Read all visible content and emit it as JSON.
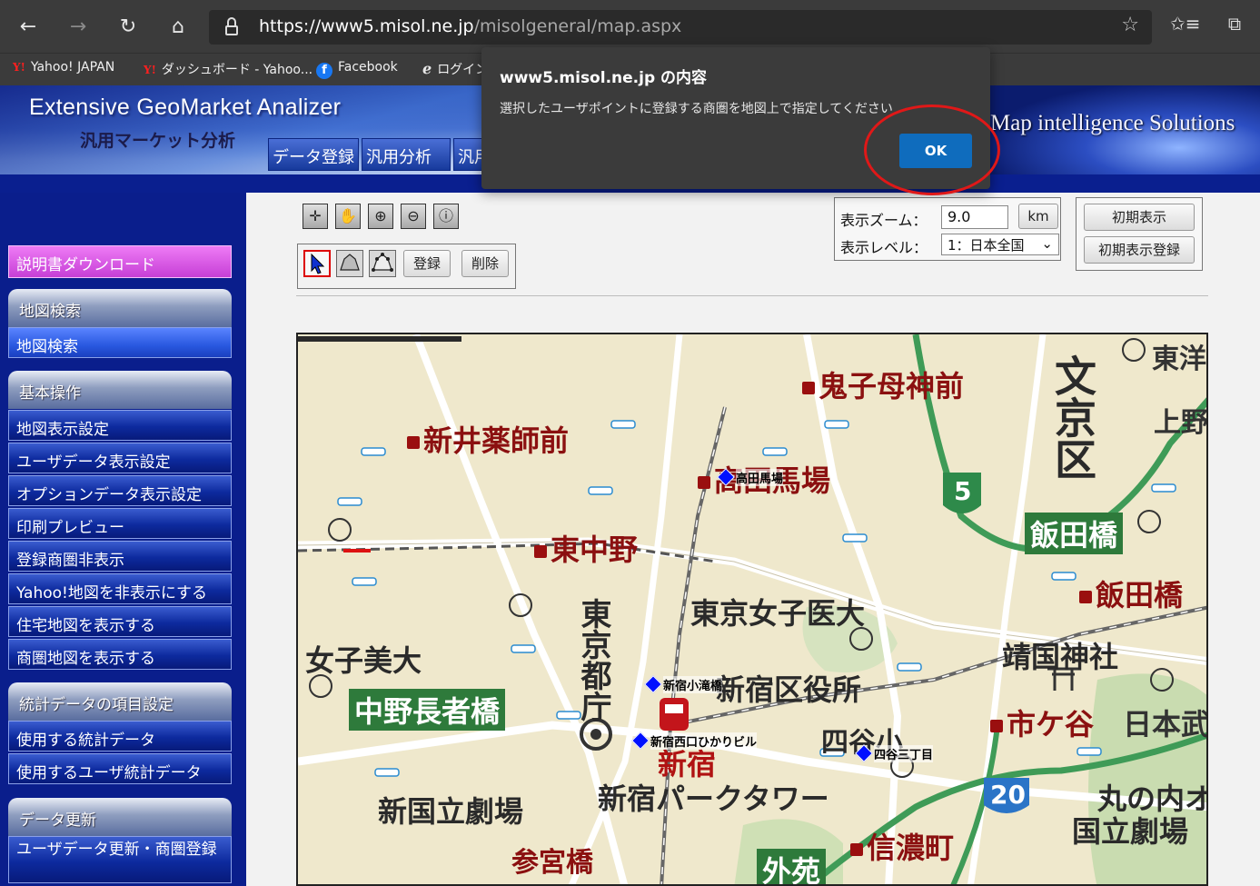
{
  "browser": {
    "url_host": "https://www5.misol.ne.jp",
    "url_path": "/misolgeneral/map.aspx",
    "back_icon": "←",
    "forward_icon": "→",
    "reload_icon": "↻",
    "home_icon": "⌂",
    "star_icon": "☆",
    "favorites_icon": "✩≡",
    "collections_icon": "⧉",
    "bookmarks": [
      {
        "label": "Yahoo! JAPAN",
        "icon": "yahoo-icon"
      },
      {
        "label": "ダッシュボード - Yahoo...",
        "icon": "yahoo-icon"
      },
      {
        "label": "Facebook",
        "icon": "facebook-icon"
      },
      {
        "label": "ログイン",
        "icon": "login-icon"
      }
    ]
  },
  "header": {
    "title": "Extensive GeoMarket Analizer",
    "subtitle": "汎用マーケット分析",
    "tabs": [
      "データ登録",
      "汎用分析",
      "汎用"
    ],
    "tagline": "Map intelligence Solutions"
  },
  "sidebar": {
    "download": "説明書ダウンロード",
    "sections": [
      {
        "title": "地図検索",
        "items": [
          "地図検索"
        ]
      },
      {
        "title": "基本操作",
        "items": [
          "地図表示設定",
          "ユーザデータ表示設定",
          "オプションデータ表示設定",
          "印刷プレビュー",
          "登録商圏非表示",
          "Yahoo!地図を非表示にする",
          "住宅地図を表示する",
          "商圏地図を表示する"
        ]
      },
      {
        "title": "統計データの項目設定",
        "items": [
          "使用する統計データ",
          "使用するユーザ統計データ"
        ]
      },
      {
        "title": "データ更新",
        "items": [
          "ユーザデータ更新・商圏登録"
        ]
      }
    ]
  },
  "toolbar": {
    "register": "登録",
    "delete": "削除",
    "zoom_label": "表示ズーム：",
    "zoom_value": "9.0",
    "zoom_unit": "km",
    "level_label": "表示レベル：",
    "level_value": "1：日本全国",
    "init_display": "初期表示",
    "init_register": "初期表示登録"
  },
  "map": {
    "labels": {
      "kishimojin": "鬼子母神前",
      "shinarai": "新井薬師前",
      "takadanobaba": "高田馬場",
      "higashinakano": "東中野",
      "bunkyo": "文京区",
      "iidabashi_box": "飯田橋",
      "iidabashi": "飯田橋",
      "joshiidai": "東京女子医大",
      "joshibidai": "女子美大",
      "tochou": "東京都庁",
      "nakanochoja": "中野長者橋",
      "shinjuku_ward": "新宿区役所",
      "yasukuni": "靖国神社",
      "ichigaya": "市ケ谷",
      "shinjuku": "新宿",
      "yotsuya_elem": "四谷小",
      "park_tower": "新宿パークタワー",
      "national_theater": "新国立劇場",
      "sangubashi": "参宮橋",
      "shinanomachi": "信濃町",
      "gaien": "外苑",
      "marunouchi": "丸の内オ",
      "kokuritsu": "国立劇場",
      "nihon_budo": "日本武",
      "route5": "5",
      "route20": "20",
      "tozai": "東洋",
      "ueno": "上野"
    },
    "pins": [
      {
        "label": "高田馬場"
      },
      {
        "label": "新宿小滝橋"
      },
      {
        "label": "新宿西口ひかりビル"
      },
      {
        "label": "四谷三丁目"
      }
    ]
  },
  "dialog": {
    "title": "www5.misol.ne.jp の内容",
    "message": "選択したユーザポイントに登録する商圏を地図上で指定してください",
    "ok": "OK"
  },
  "colors": {
    "sidebar_bg": "#0a1e8c",
    "dialog_bg": "#3b3b3b",
    "ok_button": "#0f6cbd",
    "highlight_ring": "#e01818"
  }
}
